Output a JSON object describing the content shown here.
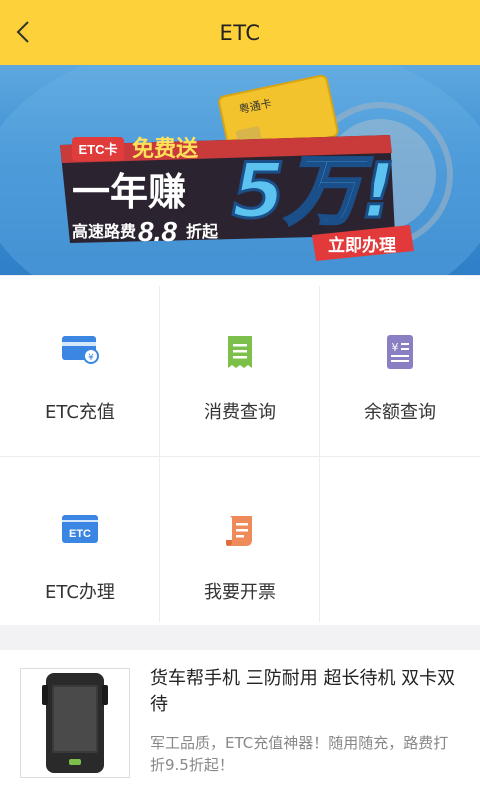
{
  "header": {
    "title": "ETC",
    "back_icon": "chevron-left-icon"
  },
  "banner": {
    "tag": "ETC卡",
    "free_text": "免费送",
    "headline": "一年赚",
    "big_amount": "5万!",
    "toll_text": "高速路费",
    "discount": "8.8",
    "discount_suffix": "折起",
    "cta": "立即办理",
    "card_brand": "粤通卡"
  },
  "services": [
    {
      "label": "ETC充值",
      "icon": "card-yuan-icon",
      "color": "#3b86e3"
    },
    {
      "label": "消费查询",
      "icon": "receipt-icon",
      "color": "#7cbf4a"
    },
    {
      "label": "余额查询",
      "icon": "balance-document-icon",
      "color": "#8b7fc4"
    },
    {
      "label": "ETC办理",
      "icon": "etc-card-icon",
      "color": "#3b86e3"
    },
    {
      "label": "我要开票",
      "icon": "invoice-scroll-icon",
      "color": "#ef8a5a"
    }
  ],
  "product": {
    "title": "货车帮手机 三防耐用 超长待机 双卡双待",
    "description": "军工品质，ETC充值神器！随用随充，路费打折9.5折起！"
  },
  "colors": {
    "header_bg": "#fdd13a",
    "banner_bg": "#3e8fd3",
    "accent_red": "#e23a3a"
  }
}
